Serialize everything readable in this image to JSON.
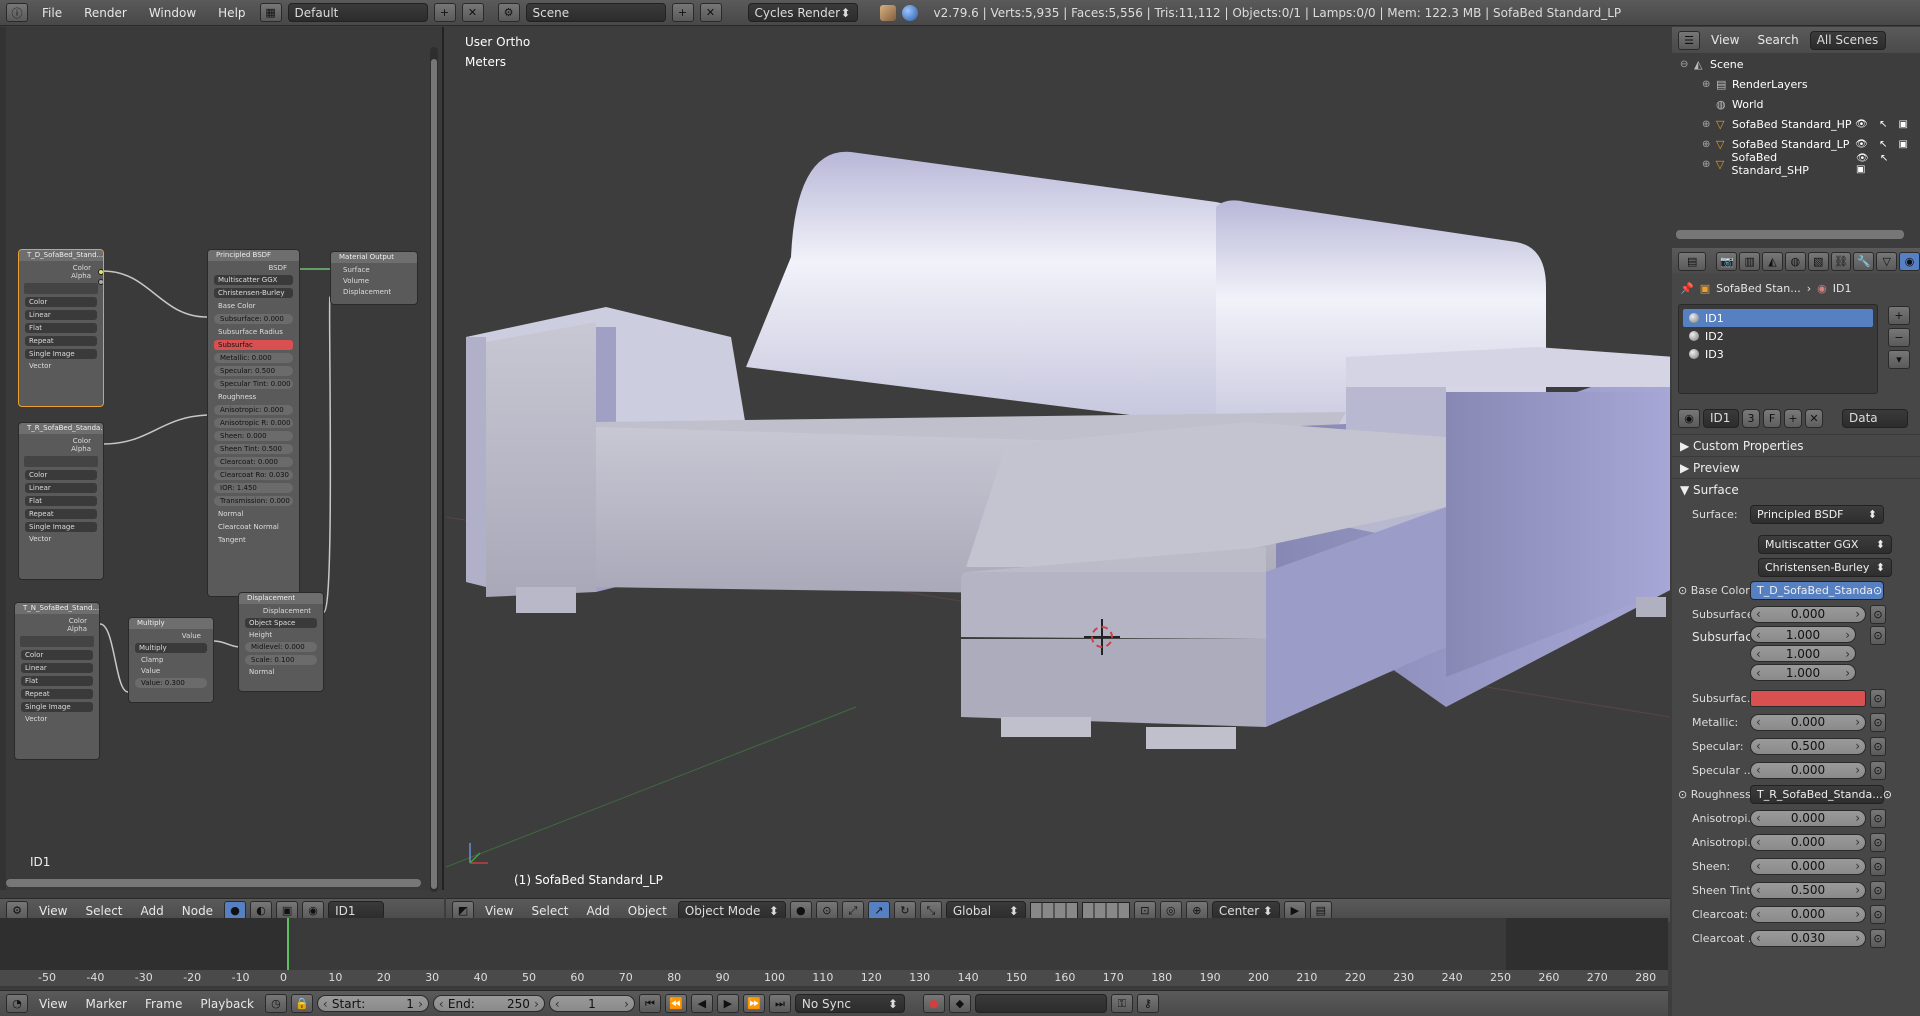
{
  "topbar": {
    "menus": [
      "File",
      "Render",
      "Window",
      "Help"
    ],
    "layout": "Default",
    "scene": "Scene",
    "engine": "Cycles Render",
    "stats": "v2.79.6 | Verts:5,935 | Faces:5,556 | Tris:11,112 | Objects:0/1 | Lamps:0/0 | Mem: 122.3 MB | SofaBed Standard_LP"
  },
  "node_editor": {
    "material_label": "ID1",
    "tex1": {
      "title": "T_D_SofaBed_Stand...",
      "out1": "Color",
      "out2": "Alpha",
      "opts": [
        "Color",
        "Linear",
        "Flat",
        "Repeat",
        "Single Image"
      ],
      "in": "Vector"
    },
    "tex2": {
      "title": "T_R_SofaBed_Standa...",
      "out1": "Color",
      "out2": "Alpha",
      "opts": [
        "Color",
        "Linear",
        "Flat",
        "Repeat",
        "Single Image"
      ],
      "in": "Vector"
    },
    "tex3": {
      "title": "T_N_SofaBed_Stand...",
      "out1": "Color",
      "out2": "Alpha",
      "opts": [
        "Color",
        "Linear",
        "Flat",
        "Repeat",
        "Single Image"
      ],
      "in": "Vector"
    },
    "bsdf": {
      "title": "Principled BSDF",
      "out": "BSDF",
      "dist": "Multiscatter GGX",
      "sss": "Christensen-Burley",
      "rows": [
        "Base Color",
        "Subsurface: 0.000",
        "Subsurface Radius",
        "Subsurfac",
        "Metallic: 0.000",
        "Specular: 0.500",
        "Specular Tint: 0.000",
        "Roughness",
        "Anisotropic: 0.000",
        "Anisotropic R: 0.000",
        "Sheen: 0.000",
        "Sheen Tint: 0.500",
        "Clearcoat: 0.000",
        "Clearcoat Ro: 0.030",
        "IOR: 1.450",
        "Transmission: 0.000",
        "Normal",
        "Clearcoat Normal",
        "Tangent"
      ]
    },
    "output": {
      "title": "Material Output",
      "rows": [
        "Surface",
        "Volume",
        "Displacement"
      ]
    },
    "multiply": {
      "title": "Multiply",
      "out": "Value",
      "op": "Multiply",
      "clamp": "Clamp",
      "in": "Value",
      "value": "Value: 0.300"
    },
    "disp": {
      "title": "Displacement",
      "out": "Displacement",
      "space": "Object Space",
      "rows": [
        "Height",
        "Midlevel: 0.000",
        "Scale: 0.100",
        "Normal"
      ]
    },
    "header": {
      "menus": [
        "View",
        "Select",
        "Add",
        "Node"
      ],
      "material": "ID1"
    }
  },
  "viewport": {
    "view_name": "User Ortho",
    "units": "Meters",
    "object_label": "(1) SofaBed Standard_LP",
    "header": {
      "menus": [
        "View",
        "Select",
        "Add",
        "Object"
      ],
      "mode": "Object Mode",
      "orientation": "Global",
      "pivot": "Center"
    }
  },
  "outliner": {
    "menus": [
      "View",
      "Search"
    ],
    "filter": "All Scenes",
    "items": [
      {
        "label": "Scene",
        "indent": 0
      },
      {
        "label": "RenderLayers",
        "indent": 1
      },
      {
        "label": "World",
        "indent": 1
      },
      {
        "label": "SofaBed Standard_HP",
        "indent": 1
      },
      {
        "label": "SofaBed Standard_LP",
        "indent": 1
      },
      {
        "label": "SofaBed Standard_SHP",
        "indent": 1
      }
    ]
  },
  "properties": {
    "breadcrumb_object": "SofaBed Stan...",
    "breadcrumb_material": "ID1",
    "slots": [
      "ID1",
      "ID2",
      "ID3"
    ],
    "material_name": "ID1",
    "users": "3",
    "fake": "F",
    "link": "Data",
    "panels": {
      "custom": "Custom Properties",
      "preview": "Preview",
      "surface": "Surface"
    },
    "surface_label": "Surface:",
    "surface_value": "Principled BSDF",
    "distribution": "Multiscatter GGX",
    "sss_method": "Christensen-Burley",
    "base_color_label": "Base Color:",
    "base_color_value": "T_D_SofaBed_Standa",
    "subsurface_label": "Subsurface:",
    "subsurface_value": "0.000",
    "radius_label": "Subsurfac...",
    "radius": [
      "1.000",
      "1.000",
      "1.000"
    ],
    "sss_color_label": "Subsurfac...",
    "fields": [
      {
        "label": "Metallic:",
        "value": "0.000"
      },
      {
        "label": "Specular:",
        "value": "0.500"
      },
      {
        "label": "Specular ...",
        "value": "0.000"
      }
    ],
    "roughness_label": "Roughness:",
    "roughness_value": "T_R_SofaBed_Standa...",
    "fields2": [
      {
        "label": "Anisotropi...",
        "value": "0.000"
      },
      {
        "label": "Anisotropi...",
        "value": "0.000"
      },
      {
        "label": "Sheen:",
        "value": "0.000"
      },
      {
        "label": "Sheen Tint:",
        "value": "0.500"
      },
      {
        "label": "Clearcoat:",
        "value": "0.000"
      },
      {
        "label": "Clearcoat ...",
        "value": "0.030"
      }
    ]
  },
  "timeline": {
    "ticks": [
      "-50",
      "-40",
      "-30",
      "-20",
      "-10",
      "0",
      "10",
      "20",
      "30",
      "40",
      "50",
      "60",
      "70",
      "80",
      "90",
      "100",
      "110",
      "120",
      "130",
      "140",
      "150",
      "160",
      "170",
      "180",
      "190",
      "200",
      "210",
      "220",
      "230",
      "240",
      "250",
      "260",
      "270",
      "280"
    ],
    "menus": [
      "View",
      "Marker",
      "Frame",
      "Playback"
    ],
    "start": "Start:",
    "start_val": "1",
    "end": "End:",
    "end_val": "250",
    "current": "1",
    "sync": "No Sync"
  },
  "colors": {
    "accent": "#5680c2",
    "sss_red": "#d95050",
    "node_select": "#e8a030"
  }
}
